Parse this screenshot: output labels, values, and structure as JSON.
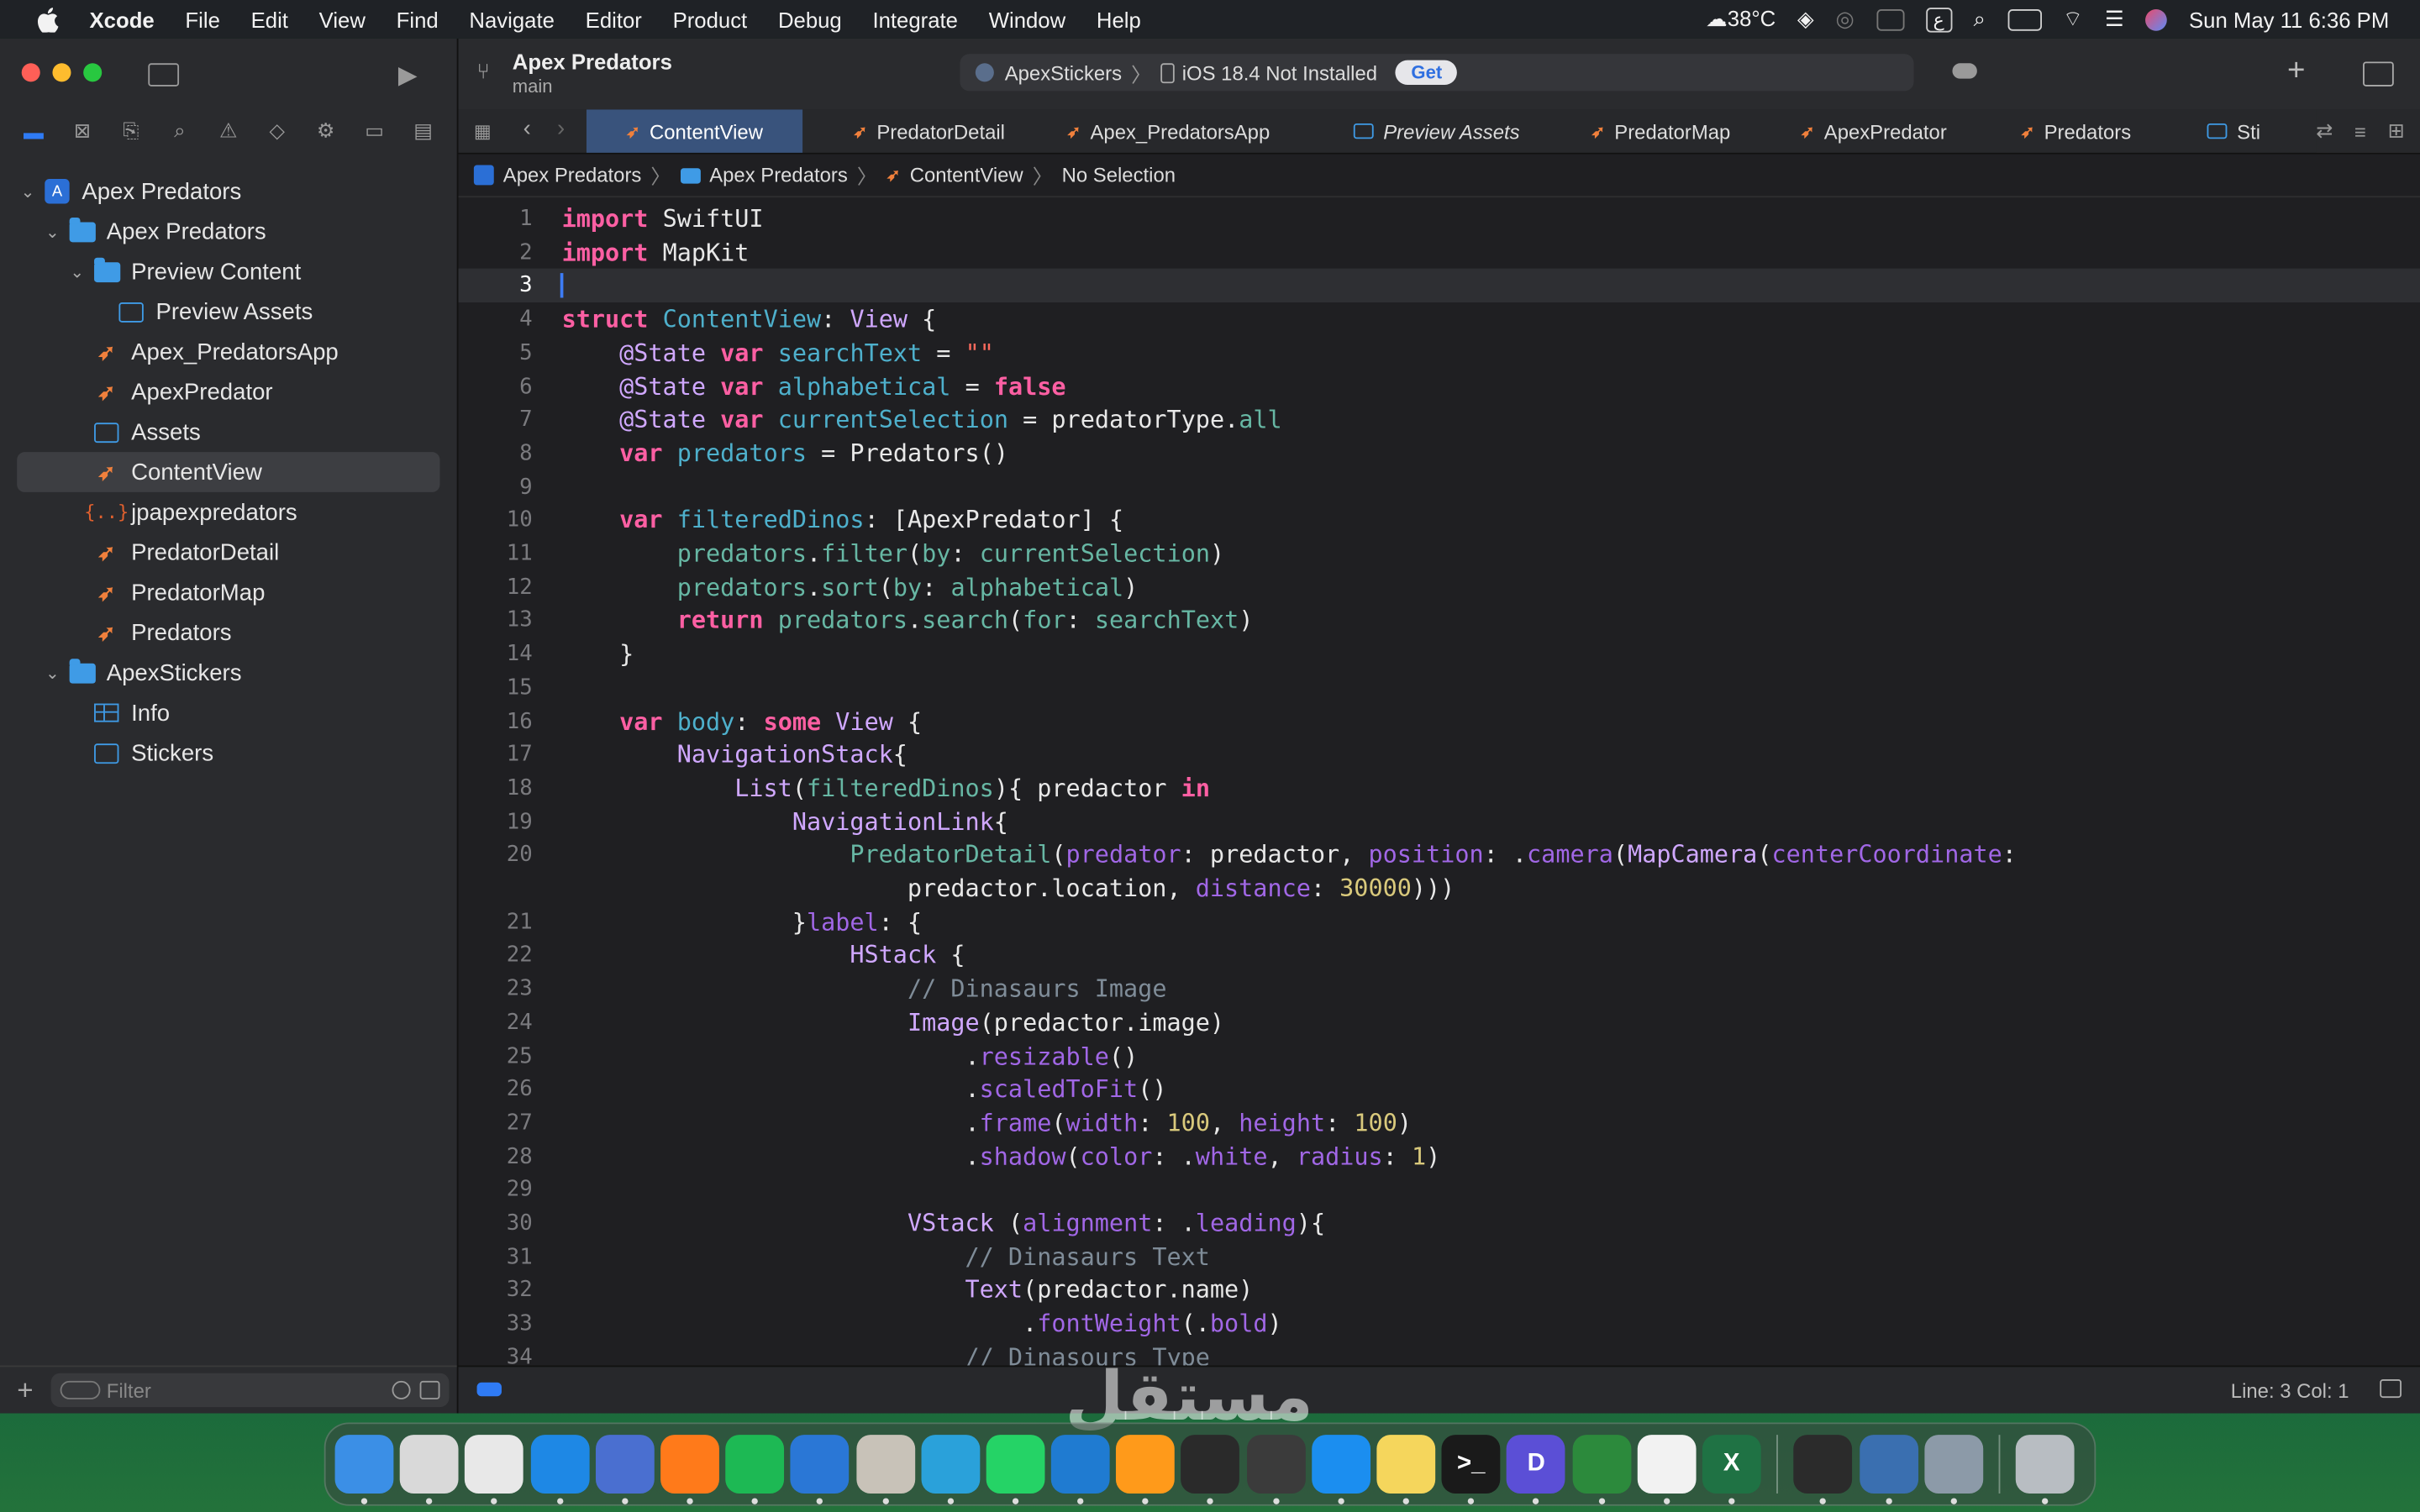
{
  "menubar": {
    "app_name": "Xcode",
    "items": [
      "File",
      "Edit",
      "View",
      "Find",
      "Navigate",
      "Editor",
      "Product",
      "Debug",
      "Integrate",
      "Window",
      "Help"
    ],
    "weather": "38°C",
    "input_source": "ع",
    "clock": "Sun May 11  6:36 PM"
  },
  "toolbar": {
    "project_name": "Apex Predators",
    "branch": "main",
    "scheme": "ApexStickers",
    "destination": "iOS 18.4 Not Installed",
    "get_button": "Get"
  },
  "tabs": [
    {
      "label": "ContentView",
      "kind": "swift",
      "active": true
    },
    {
      "label": "PredatorDetail",
      "kind": "swift"
    },
    {
      "label": "Apex_PredatorsApp",
      "kind": "swift"
    },
    {
      "label": "Preview Assets",
      "kind": "asset",
      "italic": true
    },
    {
      "label": "PredatorMap",
      "kind": "swift"
    },
    {
      "label": "ApexPredator",
      "kind": "swift"
    },
    {
      "label": "Predators",
      "kind": "swift"
    },
    {
      "label": "Sti",
      "kind": "asset"
    }
  ],
  "jumpbar": [
    "Apex Predators",
    "Apex Predators",
    "ContentView",
    "No Selection"
  ],
  "navigator": {
    "items": [
      {
        "label": "Apex Predators",
        "kind": "project",
        "level": 0,
        "chevron": "open"
      },
      {
        "label": "Apex Predators",
        "kind": "folder",
        "level": 1,
        "chevron": "open"
      },
      {
        "label": "Preview Content",
        "kind": "folder",
        "level": 2,
        "chevron": "open"
      },
      {
        "label": "Preview Assets",
        "kind": "asset",
        "level": 3
      },
      {
        "label": "Apex_PredatorsApp",
        "kind": "swift",
        "level": 2
      },
      {
        "label": "ApexPredator",
        "kind": "swift",
        "level": 2
      },
      {
        "label": "Assets",
        "kind": "asset",
        "level": 2
      },
      {
        "label": "ContentView",
        "kind": "swift",
        "level": 2,
        "selected": true
      },
      {
        "label": "jpapexpredators",
        "kind": "json",
        "level": 2
      },
      {
        "label": "PredatorDetail",
        "kind": "swift",
        "level": 2
      },
      {
        "label": "PredatorMap",
        "kind": "swift",
        "level": 2
      },
      {
        "label": "Predators",
        "kind": "swift",
        "level": 2
      },
      {
        "label": "ApexStickers",
        "kind": "folder",
        "level": 1,
        "chevron": "open"
      },
      {
        "label": "Info",
        "kind": "table",
        "level": 2
      },
      {
        "label": "Stickers",
        "kind": "asset",
        "level": 2
      }
    ],
    "filter_placeholder": "Filter"
  },
  "code": {
    "current_line": 3,
    "lines": [
      {
        "n": "1",
        "html": "<span class='k'>import</span> SwiftUI"
      },
      {
        "n": "2",
        "html": "<span class='k'>import</span> MapKit"
      },
      {
        "n": "3",
        "html": ""
      },
      {
        "n": "4",
        "html": "<span class='k'>struct</span> <span class='id'>ContentView</span>: <span class='t'>View</span> {"
      },
      {
        "n": "5",
        "html": "    <span class='t'>@State</span> <span class='k'>var</span> <span class='id'>searchText</span> = <span class='s'>\"\"</span>"
      },
      {
        "n": "6",
        "html": "    <span class='t'>@State</span> <span class='k'>var</span> <span class='id'>alphabetical</span> = <span class='k'>false</span>"
      },
      {
        "n": "7",
        "html": "    <span class='t'>@State</span> <span class='k'>var</span> <span class='id'>currentSelection</span> = predatorType.<span class='p'>all</span>"
      },
      {
        "n": "8",
        "html": "    <span class='k'>var</span> <span class='id'>predators</span> = Predators()"
      },
      {
        "n": "9",
        "html": ""
      },
      {
        "n": "10",
        "html": "    <span class='k'>var</span> <span class='id'>filteredDinos</span>: [ApexPredator] {"
      },
      {
        "n": "11",
        "html": "        <span class='p'>predators</span>.<span class='p'>filter</span>(<span class='p'>by</span>: <span class='p'>currentSelection</span>)"
      },
      {
        "n": "12",
        "html": "        <span class='p'>predators</span>.<span class='p'>sort</span>(<span class='p'>by</span>: <span class='p'>alphabetical</span>)"
      },
      {
        "n": "13",
        "html": "        <span class='k'>return</span> <span class='p'>predators</span>.<span class='p'>search</span>(<span class='p'>for</span>: <span class='p'>searchText</span>)"
      },
      {
        "n": "14",
        "html": "    }"
      },
      {
        "n": "15",
        "html": ""
      },
      {
        "n": "16",
        "html": "    <span class='k'>var</span> <span class='id'>body</span>: <span class='k'>some</span> <span class='t'>View</span> {"
      },
      {
        "n": "17",
        "html": "        <span class='t'>NavigationStack</span>{"
      },
      {
        "n": "18",
        "html": "            <span class='t'>List</span>(<span class='p'>filteredDinos</span>){ predactor <span class='k'>in</span>"
      },
      {
        "n": "19",
        "html": "                <span class='t'>NavigationLink</span>{"
      },
      {
        "n": "20",
        "html": "                    <span class='p'>PredatorDetail</span>(<span class='m'>predator</span>: predactor, <span class='m'>position</span>: .<span class='m'>camera</span>(<span class='t'>MapCamera</span>(<span class='m'>centerCoordinate</span>:"
      },
      {
        "n": "",
        "html": "                        predactor.location, <span class='m'>distance</span>: <span class='n'>30000</span>)))"
      },
      {
        "n": "21",
        "html": "                }<span class='m'>label</span>: {"
      },
      {
        "n": "22",
        "html": "                    <span class='t'>HStack</span> {"
      },
      {
        "n": "23",
        "html": "                        <span class='c'>// Dinasaurs Image</span>"
      },
      {
        "n": "24",
        "html": "                        <span class='t'>Image</span>(predactor.image)"
      },
      {
        "n": "25",
        "html": "                            .<span class='m'>resizable</span>()"
      },
      {
        "n": "26",
        "html": "                            .<span class='m'>scaledToFit</span>()"
      },
      {
        "n": "27",
        "html": "                            .<span class='m'>frame</span>(<span class='m'>width</span>: <span class='n'>100</span>, <span class='m'>height</span>: <span class='n'>100</span>)"
      },
      {
        "n": "28",
        "html": "                            .<span class='m'>shadow</span>(<span class='m'>color</span>: .<span class='m'>white</span>, <span class='m'>radius</span>: <span class='n'>1</span>)"
      },
      {
        "n": "29",
        "html": ""
      },
      {
        "n": "30",
        "html": "                        <span class='t'>VStack</span> (<span class='m'>alignment</span>: .<span class='m'>leading</span>){"
      },
      {
        "n": "31",
        "html": "                            <span class='c'>// Dinasaurs Text</span>"
      },
      {
        "n": "32",
        "html": "                            <span class='t'>Text</span>(predactor.name)"
      },
      {
        "n": "33",
        "html": "                                .<span class='m'>fontWeight</span>(.<span class='m'>bold</span>)"
      },
      {
        "n": "34",
        "html": "                            <span class='c'>// Dinasours Type</span>"
      }
    ]
  },
  "status": {
    "position": "Line: 3  Col: 1"
  },
  "dock": {
    "apps": [
      {
        "name": "finder-app",
        "color": "#3b8fe6",
        "label": ""
      },
      {
        "name": "launchpad-app",
        "color": "#d9d9d9",
        "label": ""
      },
      {
        "name": "chrome-app",
        "color": "#e8e8e8",
        "label": ""
      },
      {
        "name": "safari-app",
        "color": "#1e88e5",
        "label": ""
      },
      {
        "name": "appcleaner-app",
        "color": "#4a6fd0",
        "label": ""
      },
      {
        "name": "firefox-app",
        "color": "#ff7a1a",
        "label": ""
      },
      {
        "name": "spotify-app",
        "color": "#1db954",
        "label": ""
      },
      {
        "name": "xcode-app",
        "color": "#2a77d6",
        "label": ""
      },
      {
        "name": "preview-app",
        "color": "#c8c2b8",
        "label": ""
      },
      {
        "name": "telegram-app",
        "color": "#2aa1da",
        "label": ""
      },
      {
        "name": "whatsapp-app",
        "color": "#25d366",
        "label": ""
      },
      {
        "name": "vscode-app",
        "color": "#1f7bd1",
        "label": ""
      },
      {
        "name": "sublime-app",
        "color": "#ff9a1a",
        "label": ""
      },
      {
        "name": "chatgpt-app",
        "color": "#2a2a2a",
        "label": ""
      },
      {
        "name": "sketch-app",
        "color": "#3b3b3b",
        "label": ""
      },
      {
        "name": "appstore-app",
        "color": "#1b8ef0",
        "label": ""
      },
      {
        "name": "notes-app",
        "color": "#f5d65c",
        "label": ""
      },
      {
        "name": "terminal-app",
        "color": "#1a1a1a",
        "label": ">_"
      },
      {
        "name": "dbeaver-app",
        "color": "#5b4fd6",
        "label": "D"
      },
      {
        "name": "activity-app",
        "color": "#2c8a3c",
        "label": ""
      },
      {
        "name": "textedit-app",
        "color": "#f2f2f2",
        "label": ""
      },
      {
        "name": "excel-app",
        "color": "#1f7244",
        "label": "X"
      }
    ],
    "right_apps": [
      {
        "name": "simulator-app",
        "color": "#2b2b2b",
        "label": ""
      },
      {
        "name": "quicktime-app",
        "color": "#3a6fb0",
        "label": ""
      },
      {
        "name": "screenshot-app",
        "color": "#8c9aa8",
        "label": ""
      }
    ],
    "trash": {
      "name": "trash-app",
      "color": "#b8bdc2",
      "label": ""
    }
  },
  "watermark": "مستقل"
}
